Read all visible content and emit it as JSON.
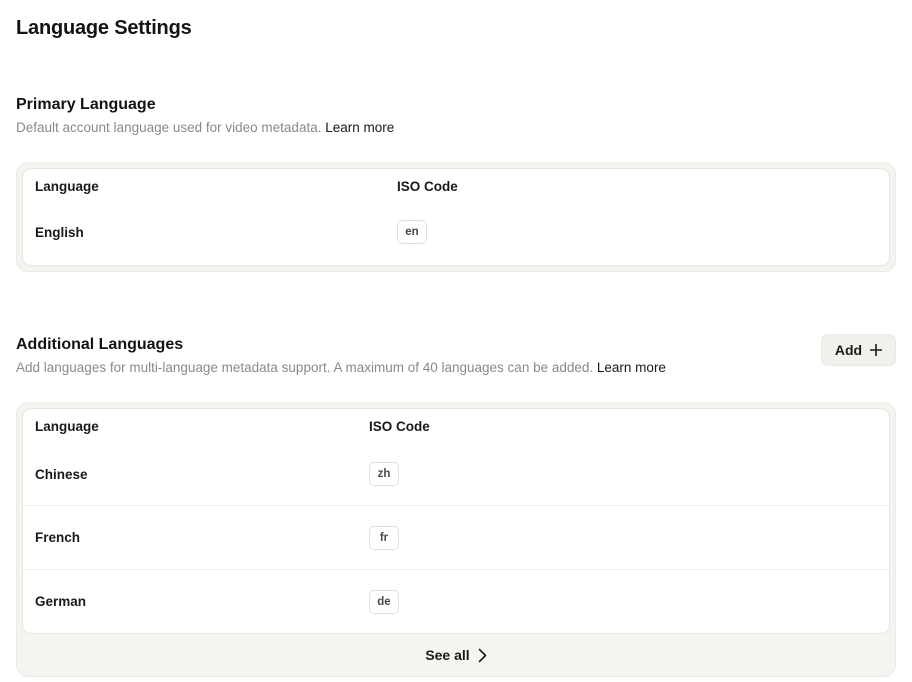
{
  "page": {
    "title": "Language Settings"
  },
  "primary": {
    "title": "Primary Language",
    "description": "Default account language used for video metadata.",
    "learn_more": "Learn more",
    "columns": {
      "language": "Language",
      "code": "ISO Code"
    },
    "rows": [
      {
        "language": "English",
        "code": "en"
      }
    ]
  },
  "additional": {
    "title": "Additional Languages",
    "description": "Add languages for multi-language metadata support. A maximum of 40 languages can be added.",
    "learn_more": "Learn more",
    "add_label": "Add",
    "add_icon": "plus-icon",
    "columns": {
      "language": "Language",
      "code": "ISO Code"
    },
    "rows": [
      {
        "language": "Chinese",
        "code": "zh"
      },
      {
        "language": "French",
        "code": "fr"
      },
      {
        "language": "German",
        "code": "de"
      }
    ],
    "see_all_label": "See all",
    "see_all_icon": "chevron-right-icon"
  }
}
